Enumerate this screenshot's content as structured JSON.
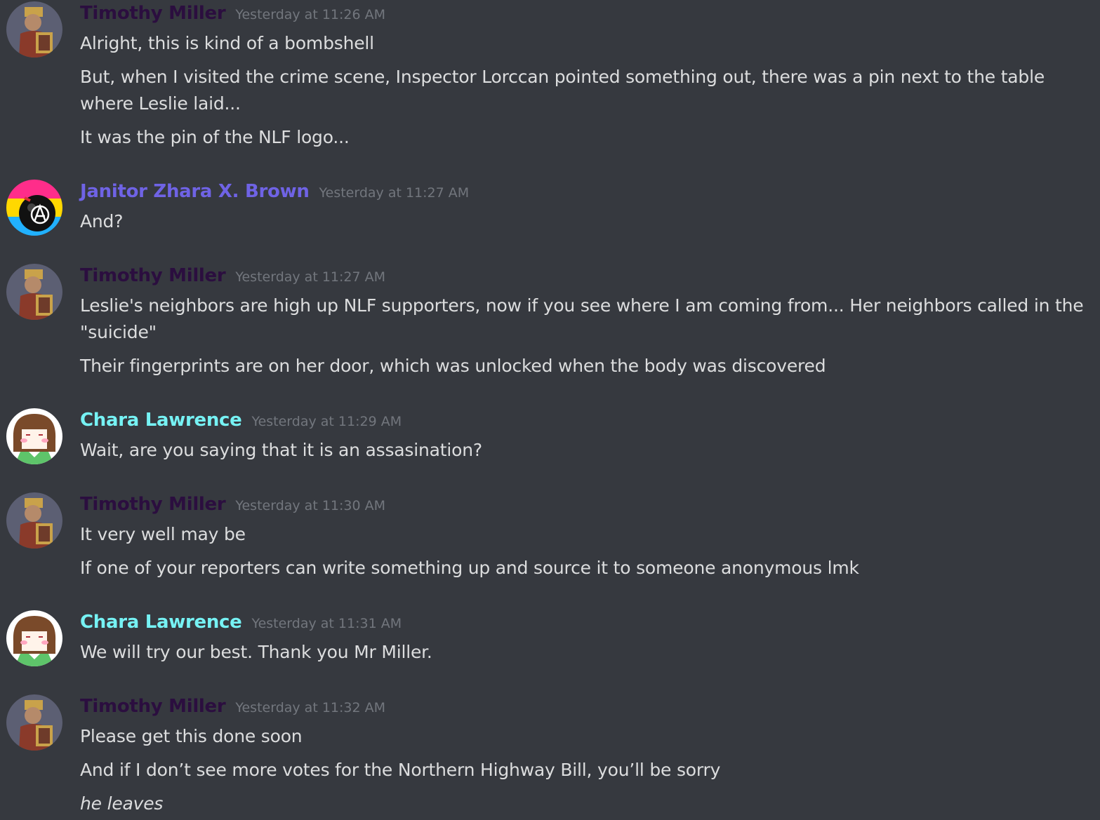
{
  "colors": {
    "background": "#36393f",
    "text": "#dcddde",
    "timestamp": "#72767d",
    "timothy_name": "#2b0e3f",
    "janitor_name": "#6f63e5",
    "chara_name": "#76f2f4"
  },
  "messages": [
    {
      "author": "Timothy Miller",
      "timestamp": "Yesterday at 11:26 AM",
      "avatar_icon": "knight-avatar-icon",
      "lines": [
        "Alright, this is kind of a bombshell",
        "But, when I visited the crime scene, Inspector Lorccan pointed something out, there was a pin next to the table where Leslie laid...",
        "It was the pin of the NLF logo..."
      ]
    },
    {
      "author": "Janitor Zhara X. Brown",
      "timestamp": "Yesterday at 11:27 AM",
      "avatar_icon": "anarchy-bomb-avatar-icon",
      "lines": [
        "And?"
      ]
    },
    {
      "author": "Timothy Miller",
      "timestamp": "Yesterday at 11:27 AM",
      "avatar_icon": "knight-avatar-icon",
      "lines": [
        "Leslie's neighbors are high up NLF supporters, now if you see where I am coming from... Her neighbors called in the \"suicide\"",
        "Their fingerprints are on her door, which was unlocked when the body was discovered"
      ]
    },
    {
      "author": "Chara Lawrence",
      "timestamp": "Yesterday at 11:29 AM",
      "avatar_icon": "chara-avatar-icon",
      "lines": [
        "Wait, are you saying that it is an assasination?"
      ]
    },
    {
      "author": "Timothy Miller",
      "timestamp": "Yesterday at 11:30 AM",
      "avatar_icon": "knight-avatar-icon",
      "lines": [
        "It very well may be",
        "If one of your reporters can write something up and source it to someone anonymous lmk"
      ]
    },
    {
      "author": "Chara Lawrence",
      "timestamp": "Yesterday at 11:31 AM",
      "avatar_icon": "chara-avatar-icon",
      "lines": [
        "We will try our best. Thank you Mr Miller."
      ]
    },
    {
      "author": "Timothy Miller",
      "timestamp": "Yesterday at 11:32 AM",
      "avatar_icon": "knight-avatar-icon",
      "lines": [
        "Please get this done soon",
        "And if I don’t see more votes for the Northern Highway Bill, you’ll be sorry",
        "he leaves"
      ]
    }
  ]
}
